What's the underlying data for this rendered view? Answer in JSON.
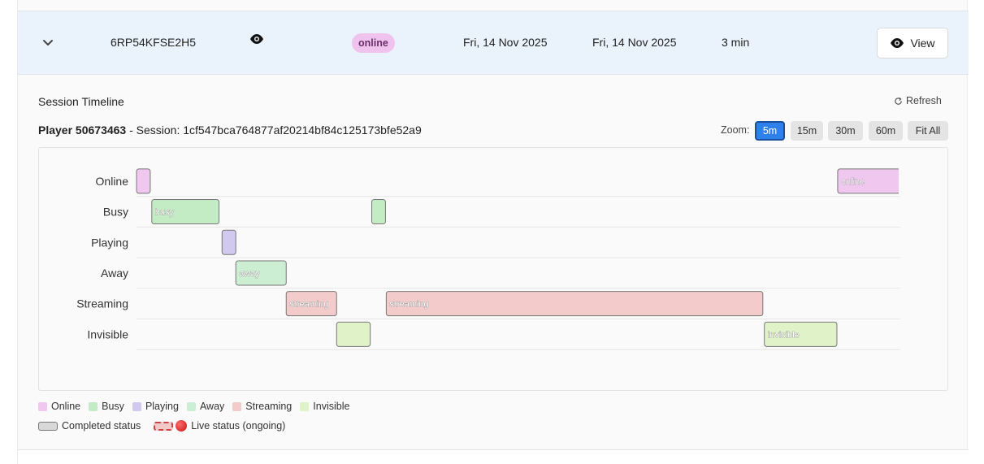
{
  "session_row": {
    "id": "6RP54KFSE2H5",
    "status": "online",
    "start_date": "Fri, 14 Nov 2025",
    "end_date": "Fri, 14 Nov 2025",
    "duration": "3 min",
    "view_label": "View",
    "status_color": "#efc3ee"
  },
  "timeline": {
    "title": "Session Timeline",
    "refresh_label": "Refresh",
    "player_label": "Player 50673463",
    "session_text": " - Session: 1cf547bca764877af20214bf84c125173bfe52a9",
    "zoom_label": "Zoom:",
    "zoom_options": [
      "5m",
      "15m",
      "30m",
      "60m",
      "Fit All"
    ],
    "zoom_selected": "5m"
  },
  "chart_data": {
    "type": "gantt",
    "rows": [
      "Online",
      "Busy",
      "Playing",
      "Away",
      "Streaming",
      "Invisible"
    ],
    "colors": {
      "Online": "#f0c8ef",
      "Busy": "#c4ecc4",
      "Playing": "#d2c9f0",
      "Away": "#ccefd3",
      "Streaming": "#f3cbcb",
      "Invisible": "#e0f2c8"
    },
    "segments": [
      {
        "row": "Online",
        "start": 0.0,
        "end": 1.8,
        "label": ""
      },
      {
        "row": "Busy",
        "start": 2.0,
        "end": 10.8,
        "label": "busy"
      },
      {
        "row": "Playing",
        "start": 11.2,
        "end": 13.0,
        "label": ""
      },
      {
        "row": "Away",
        "start": 13.0,
        "end": 19.6,
        "label": "away"
      },
      {
        "row": "Streaming",
        "start": 19.6,
        "end": 26.2,
        "label": "streaming"
      },
      {
        "row": "Invisible",
        "start": 26.2,
        "end": 30.6,
        "label": ""
      },
      {
        "row": "Busy",
        "start": 30.8,
        "end": 32.6,
        "label": ""
      },
      {
        "row": "Streaming",
        "start": 32.7,
        "end": 82.0,
        "label": "streaming"
      },
      {
        "row": "Invisible",
        "start": 82.2,
        "end": 91.7,
        "label": "invisible"
      },
      {
        "row": "Online",
        "start": 91.8,
        "end": 100.0,
        "label": "online"
      }
    ],
    "x_range": [
      0,
      100
    ]
  },
  "legend": {
    "items": [
      {
        "label": "Online",
        "color": "#f0c8ef"
      },
      {
        "label": "Busy",
        "color": "#c4ecc4"
      },
      {
        "label": "Playing",
        "color": "#d2c9f0"
      },
      {
        "label": "Away",
        "color": "#ccefd3"
      },
      {
        "label": "Streaming",
        "color": "#f3cbcb"
      },
      {
        "label": "Invisible",
        "color": "#e0f2c8"
      }
    ],
    "completed_label": "Completed status",
    "live_label": "Live status (ongoing)"
  }
}
